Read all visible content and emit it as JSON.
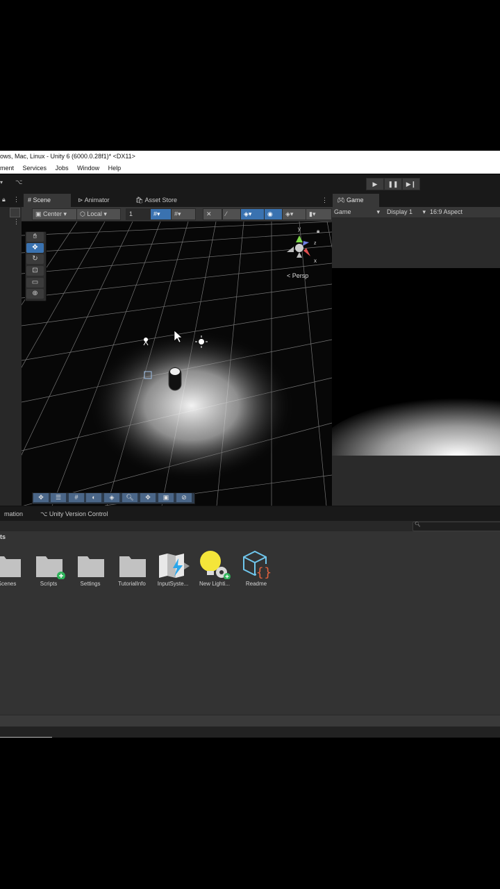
{
  "window": {
    "title": "ows, Mac, Linux - Unity 6 (6000.0.28f1)* <DX11>"
  },
  "menu": [
    "ment",
    "Services",
    "Jobs",
    "Window",
    "Help"
  ],
  "toolbar": {
    "play": "▶",
    "pause": "❚❚",
    "step": "▶❙"
  },
  "scene_tabs": {
    "scene": "Scene",
    "animator": "Animator",
    "asset_store": "Asset Store"
  },
  "scene_toolbar": {
    "pivot": "Center",
    "space": "Local",
    "grid_value": "1"
  },
  "scene_view": {
    "camera_mode": "< Persp",
    "axis_y": "y",
    "axis_x": "x",
    "axis_z": "z"
  },
  "game": {
    "tab": "Game",
    "mode": "Game",
    "display": "Display 1",
    "aspect": "16:9 Aspect"
  },
  "bottom_tabs": {
    "animation": "mation",
    "version_control": "Unity Version Control"
  },
  "project": {
    "breadcrumb": "ts",
    "assets": [
      {
        "label": "Scenes",
        "icon": "folder-icon"
      },
      {
        "label": "Scripts",
        "icon": "folder-add-icon"
      },
      {
        "label": "Settings",
        "icon": "folder-icon"
      },
      {
        "label": "TutorialInfo",
        "icon": "folder-icon"
      },
      {
        "label": "InputSyste...",
        "icon": "input-actions-icon"
      },
      {
        "label": "New Lighti...",
        "icon": "lighting-settings-icon"
      },
      {
        "label": "Readme",
        "icon": "readme-icon"
      }
    ]
  },
  "colors": {
    "accent_blue": "#3a72b0",
    "panel_dark": "#282828",
    "panel_mid": "#383838"
  }
}
